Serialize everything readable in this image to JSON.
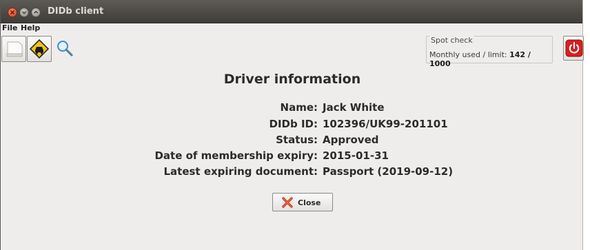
{
  "window": {
    "title": "DIDb client"
  },
  "menu": {
    "items": [
      "File",
      "Help"
    ]
  },
  "toolbar": {
    "buttons": [
      {
        "icon": "blank-card-icon"
      },
      {
        "icon": "car-warning-icon"
      },
      {
        "icon": "magnifier-icon"
      }
    ]
  },
  "spot_check": {
    "label": "Spot check",
    "prefix": "Monthly used / limit: ",
    "value": "142 / 1000"
  },
  "power": {
    "icon": "power-icon"
  },
  "main": {
    "heading": "Driver information",
    "fields": [
      {
        "label": "Name:",
        "value": "Jack White"
      },
      {
        "label": "DIDb ID:",
        "value": "102396/UK99-201101"
      },
      {
        "label": "Status:",
        "value": "Approved"
      },
      {
        "label": "Date of membership expiry:",
        "value": "2015-01-31"
      },
      {
        "label": "Latest expiring document:",
        "value": "Passport (2019-09-12)"
      }
    ],
    "close_label": "Close"
  },
  "colors": {
    "accent_red": "#d81e1e",
    "title_bar": "#4a4844"
  }
}
